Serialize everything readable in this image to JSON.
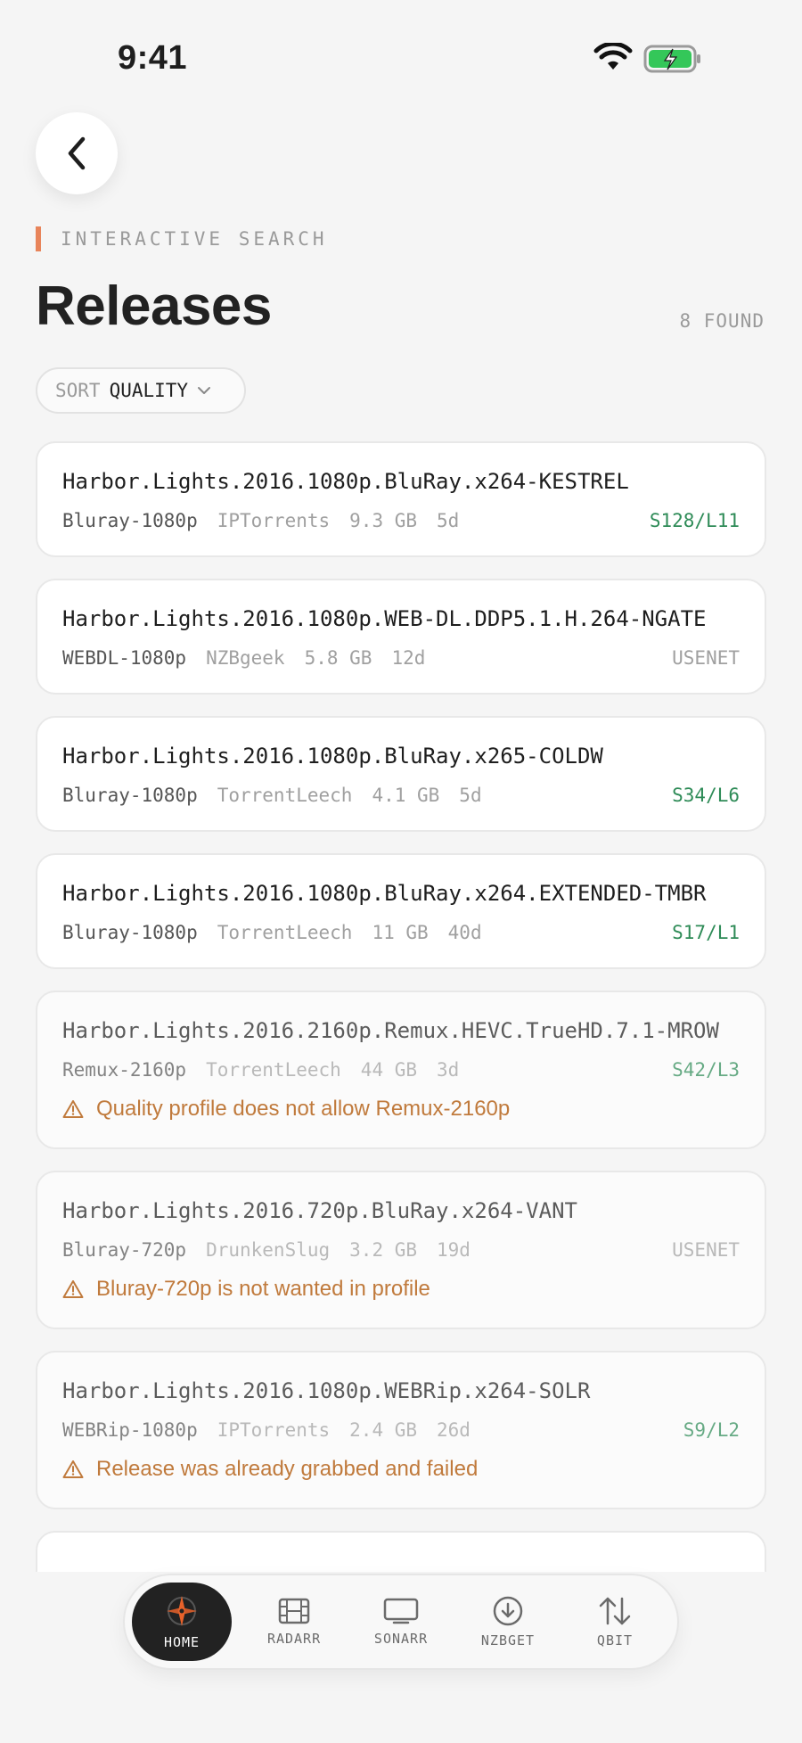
{
  "status_bar": {
    "time": "9:41"
  },
  "header": {
    "eyebrow": "INTERACTIVE SEARCH",
    "title": "Releases",
    "found_count": "8 FOUND"
  },
  "sort": {
    "label": "SORT",
    "value": "QUALITY"
  },
  "releases": [
    {
      "title": "Harbor.Lights.2016.1080p.BluRay.x264-KESTREL",
      "quality": "Bluray-1080p",
      "indexer": "IPTorrents",
      "size": "9.3 GB",
      "age": "5d",
      "peers": "S128/L11",
      "peers_type": "torrent",
      "warning": ""
    },
    {
      "title": "Harbor.Lights.2016.1080p.WEB-DL.DDP5.1.H.264-NGATE",
      "quality": "WEBDL-1080p",
      "indexer": "NZBgeek",
      "size": "5.8 GB",
      "age": "12d",
      "peers": "USENET",
      "peers_type": "usenet",
      "warning": ""
    },
    {
      "title": "Harbor.Lights.2016.1080p.BluRay.x265-COLDW",
      "quality": "Bluray-1080p",
      "indexer": "TorrentLeech",
      "size": "4.1 GB",
      "age": "5d",
      "peers": "S34/L6",
      "peers_type": "torrent",
      "warning": ""
    },
    {
      "title": "Harbor.Lights.2016.1080p.BluRay.x264.EXTENDED-TMBR",
      "quality": "Bluray-1080p",
      "indexer": "TorrentLeech",
      "size": "11 GB",
      "age": "40d",
      "peers": "S17/L1",
      "peers_type": "torrent",
      "warning": ""
    },
    {
      "title": "Harbor.Lights.2016.2160p.Remux.HEVC.TrueHD.7.1-MROW",
      "quality": "Remux-2160p",
      "indexer": "TorrentLeech",
      "size": "44 GB",
      "age": "3d",
      "peers": "S42/L3",
      "peers_type": "torrent",
      "warning": "Quality profile does not allow Remux-2160p"
    },
    {
      "title": "Harbor.Lights.2016.720p.BluRay.x264-VANT",
      "quality": "Bluray-720p",
      "indexer": "DrunkenSlug",
      "size": "3.2 GB",
      "age": "19d",
      "peers": "USENET",
      "peers_type": "usenet",
      "warning": "Bluray-720p is not wanted in profile"
    },
    {
      "title": "Harbor.Lights.2016.1080p.WEBRip.x264-SOLR",
      "quality": "WEBRip-1080p",
      "indexer": "IPTorrents",
      "size": "2.4 GB",
      "age": "26d",
      "peers": "S9/L2",
      "peers_type": "torrent",
      "warning": "Release was already grabbed and failed"
    }
  ],
  "tabbar": {
    "items": [
      {
        "label": "HOME",
        "icon": "compass-icon",
        "active": true
      },
      {
        "label": "RADARR",
        "icon": "film-icon",
        "active": false
      },
      {
        "label": "SONARR",
        "icon": "tv-icon",
        "active": false
      },
      {
        "label": "NZBGET",
        "icon": "download-icon",
        "active": false
      },
      {
        "label": "QBIT",
        "icon": "transfer-arrows-icon",
        "active": false
      }
    ]
  },
  "colors": {
    "accent": "#e8845a",
    "seed_green": "#2e8b57",
    "warning": "#c07a3c",
    "background": "#f5f5f5",
    "active_tab": "#222222"
  }
}
